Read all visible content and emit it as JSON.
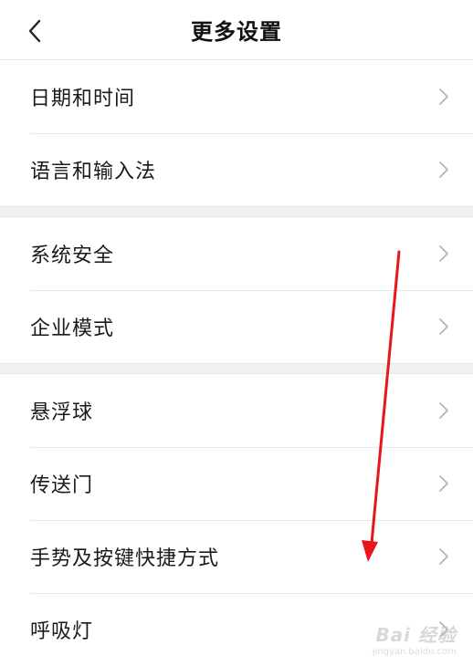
{
  "header": {
    "title": "更多设置",
    "back_icon": "chevron-left-icon"
  },
  "groups": [
    {
      "items": [
        {
          "label": "日期和时间"
        },
        {
          "label": "语言和输入法"
        }
      ]
    },
    {
      "items": [
        {
          "label": "系统安全"
        },
        {
          "label": "企业模式"
        }
      ]
    },
    {
      "items": [
        {
          "label": "悬浮球"
        },
        {
          "label": "传送门"
        },
        {
          "label": "手势及按键快捷方式"
        },
        {
          "label": "呼吸灯"
        }
      ]
    }
  ],
  "colors": {
    "annotation_arrow": "#e8161b",
    "chevron": "#b5b5b5",
    "divider": "#e8e8e8",
    "group_gap": "#f1f1f1"
  },
  "watermark": {
    "logo": "Bai 经验",
    "sub": "jingyan.baidu.com"
  }
}
